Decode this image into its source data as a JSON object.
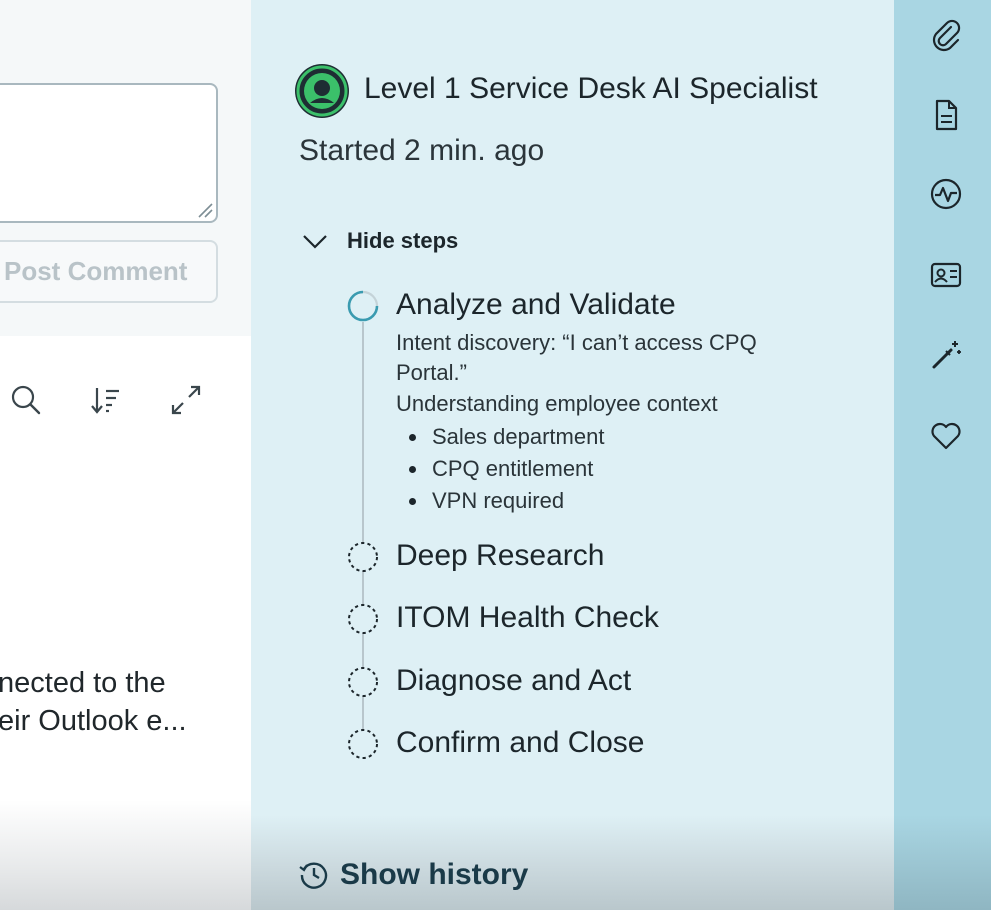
{
  "left_panel": {
    "post_comment_label": "Post Comment",
    "snippet_lines": [
      "nected to the",
      "eir Outlook e..."
    ]
  },
  "agent": {
    "title": "Level 1 Service Desk AI Specialist",
    "started": "Started 2 min. ago",
    "hide_steps_label": "Hide steps",
    "steps": [
      {
        "label": "Analyze and Validate",
        "status": "in-progress",
        "details": [
          "Intent discovery: “I can’t access CPQ Portal.”",
          "Understanding employee context"
        ],
        "bullets": [
          "Sales department",
          "CPQ entitlement",
          "VPN required"
        ]
      },
      {
        "label": "Deep Research",
        "status": "pending"
      },
      {
        "label": "ITOM Health Check",
        "status": "pending"
      },
      {
        "label": "Diagnose and Act",
        "status": "pending"
      },
      {
        "label": "Confirm and Close",
        "status": "pending"
      }
    ],
    "show_history_label": "Show history"
  },
  "rail": {
    "icons": [
      "paperclip-icon",
      "document-icon",
      "activity-icon",
      "contact-card-icon",
      "magic-wand-icon",
      "heart-icon"
    ]
  },
  "colors": {
    "panel_bg": "#def0f5",
    "rail_bg": "#a9d6e3",
    "accent_teal": "#3a9bb0",
    "avatar_green": "#3bc06a"
  }
}
